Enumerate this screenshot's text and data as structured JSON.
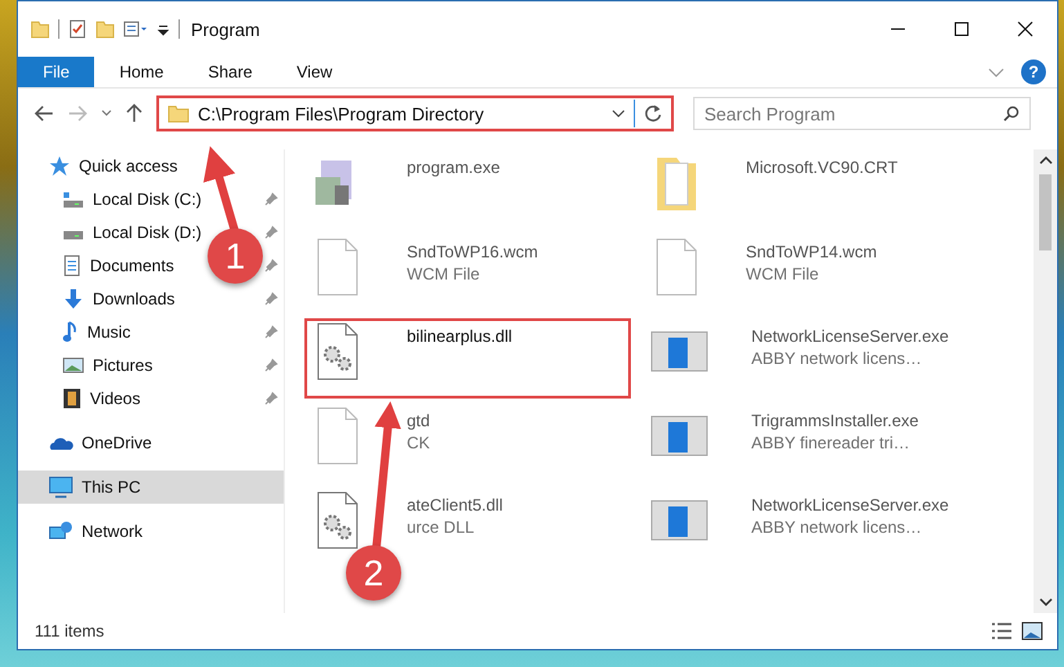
{
  "window": {
    "title": "Program"
  },
  "ribbon_tabs": [
    {
      "label": "File",
      "selected": true
    },
    {
      "label": "Home",
      "selected": false
    },
    {
      "label": "Share",
      "selected": false
    },
    {
      "label": "View",
      "selected": false
    }
  ],
  "help": {
    "label": "?"
  },
  "address": {
    "path": "C:\\Program Files\\Program Directory",
    "highlighted": true
  },
  "search": {
    "placeholder": "Search Program"
  },
  "sidebar": [
    {
      "label": "Quick access",
      "kind": "star",
      "selected": false,
      "children": [
        {
          "label": "Local Disk (C:)",
          "kind": "disk-c",
          "pinned": true
        },
        {
          "label": "Local Disk (D:)",
          "kind": "disk",
          "pinned": true
        },
        {
          "label": "Documents",
          "kind": "documents",
          "pinned": true
        },
        {
          "label": "Downloads",
          "kind": "downloads",
          "pinned": true
        },
        {
          "label": "Music",
          "kind": "music",
          "pinned": true
        },
        {
          "label": "Pictures",
          "kind": "pictures",
          "pinned": true
        },
        {
          "label": "Videos",
          "kind": "videos",
          "pinned": true
        }
      ]
    },
    {
      "label": "OneDrive",
      "kind": "cloud",
      "selected": false
    },
    {
      "label": "This PC",
      "kind": "pc",
      "selected": true
    },
    {
      "label": "Network",
      "kind": "network",
      "selected": false
    }
  ],
  "files": [
    {
      "name": "program.exe",
      "kind": "installer",
      "highlighted": false
    },
    {
      "name": "Microsoft.VC90.CRT",
      "kind": "folder",
      "highlighted": false
    },
    {
      "name": "SndToWP16.wcm",
      "detail": "WCM File",
      "kind": "page",
      "highlighted": false
    },
    {
      "name": "SndToWP14.wcm",
      "detail": "WCM File",
      "kind": "page",
      "highlighted": false
    },
    {
      "name": "bilinearplus.dll",
      "kind": "dll",
      "highlighted": true
    },
    {
      "name": "NetworkLicenseServer.exe",
      "detail": "ABBY network licens…",
      "kind": "app",
      "highlighted": false
    },
    {
      "name": "gtd",
      "detail": "CK",
      "kind": "page",
      "highlighted": false
    },
    {
      "name": "TrigrammsInstaller.exe",
      "detail": "ABBY finereader tri…",
      "kind": "app",
      "highlighted": false
    },
    {
      "name": "ateClient5.dll",
      "detail": "urce DLL",
      "kind": "dll",
      "highlighted": false
    },
    {
      "name": "NetworkLicenseServer.exe",
      "detail": "ABBY network licens…",
      "kind": "app",
      "highlighted": false
    }
  ],
  "status_bar": {
    "count": "111 items"
  },
  "annotations": [
    {
      "label": "1"
    },
    {
      "label": "2"
    }
  ]
}
